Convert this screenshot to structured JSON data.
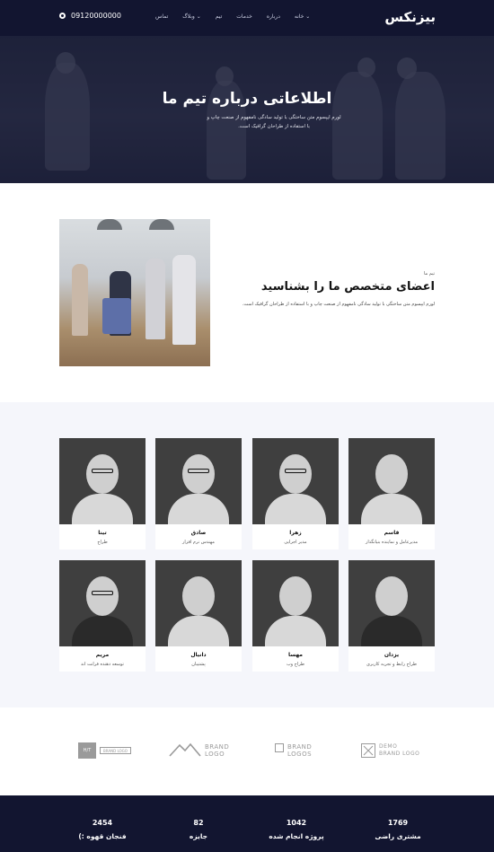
{
  "nav": {
    "brand": "بیزنکس",
    "items": [
      {
        "label": "خانه",
        "dropdown": true
      },
      {
        "label": "درباره",
        "dropdown": false
      },
      {
        "label": "خدمات",
        "dropdown": false
      },
      {
        "label": "تیم",
        "dropdown": false
      },
      {
        "label": "وبلاگ",
        "dropdown": true
      },
      {
        "label": "تماس",
        "dropdown": false
      }
    ],
    "phone": "09120000000",
    "icon": "gear-icon"
  },
  "hero": {
    "title": "اطلاعاتی درباره تیم ما",
    "subtitle": "لورم ایپسوم متن ساختگی با تولید سادگی نامفهوم از صنعت چاپ و با استفاده از طراحان گرافیک است."
  },
  "about": {
    "kicker": "تیم ما",
    "title": "اعضای متخصص ما را بشناسید",
    "text": "لورم ایپسوم متن ساختگی با تولید سادگی نامفهوم از صنعت چاپ و با استفاده از طراحان گرافیک است."
  },
  "team": [
    {
      "name": "قاسم",
      "role": "مدیرعامل و نماینده بنیانگذار"
    },
    {
      "name": "زهرا",
      "role": "مدیر اجرایی"
    },
    {
      "name": "صادق",
      "role": "مهندس نرم افزار"
    },
    {
      "name": "تینا",
      "role": "طراح"
    },
    {
      "name": "یزدان",
      "role": "طراح رابط و تجربه کاربری"
    },
    {
      "name": "مهسا",
      "role": "طراح وب"
    },
    {
      "name": "دانیال",
      "role": "پشتیبان"
    },
    {
      "name": "مریم",
      "role": "توسعه دهنده فرانت اند"
    }
  ],
  "logos": [
    {
      "line1": "DEMO",
      "line2": "BRAND LOGO",
      "icon": "cross-square-icon"
    },
    {
      "line1": "BRAND",
      "line2": "LOGOS",
      "icon": "frame-icon"
    },
    {
      "line1": "BRAND",
      "line2": "LOGO",
      "icon": "mountain-icon"
    },
    {
      "line1": "H/T",
      "line2": "BRAND LOGO",
      "icon": "ht-box-icon"
    }
  ],
  "stats": [
    {
      "value": "1769",
      "label": "مشتری راضی"
    },
    {
      "value": "1042",
      "label": "پروژه انجام شده"
    },
    {
      "value": "82",
      "label": "جایزه"
    },
    {
      "value": "2454",
      "label": "فنجان قهوه :)"
    }
  ]
}
